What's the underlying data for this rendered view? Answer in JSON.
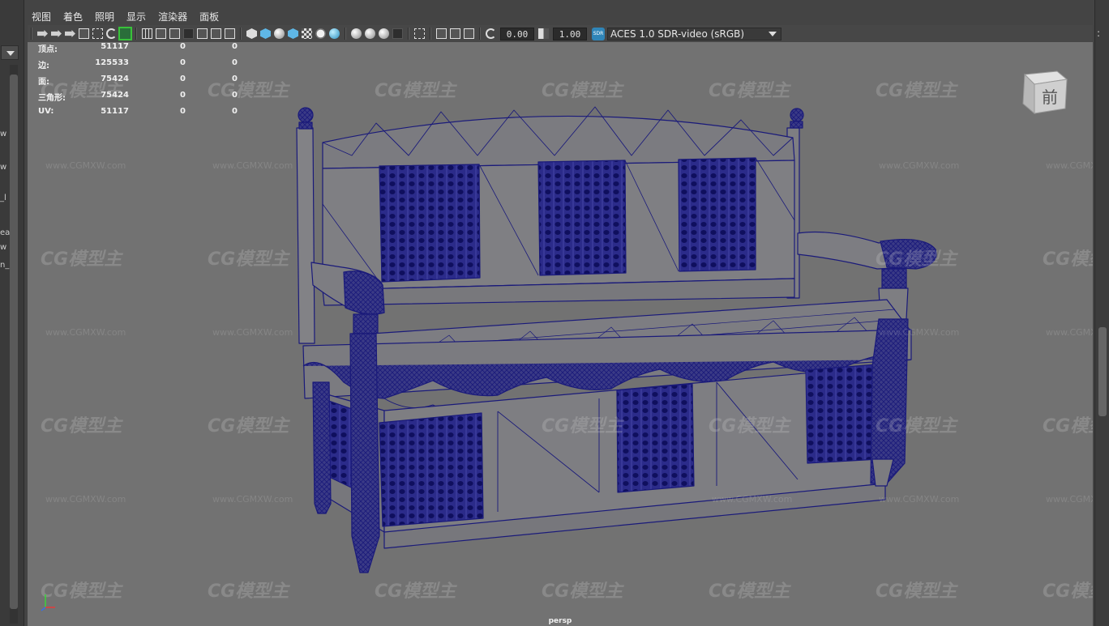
{
  "menu": [
    "视图",
    "着色",
    "照明",
    "显示",
    "渲染器",
    "面板"
  ],
  "toolbar": {
    "icons": [
      "camera-icon",
      "camera-attributes-icon",
      "bookmark-icon",
      "image-plane-icon",
      "grease-pencil-icon",
      "pencil-icon",
      "grid-icon",
      "film-gate-icon",
      "resolution-gate-icon",
      "gate-mask-icon",
      "field-chart-icon",
      "safe-action-icon",
      "safe-title-icon",
      "wireframe-icon",
      "smooth-shade-icon",
      "default-material-icon",
      "wireframe-on-shaded-icon",
      "textured-icon",
      "use-all-lights-icon",
      "shadows-icon",
      "screen-space-ambient-occlusion-icon",
      "motion-blur-icon",
      "multisample-aa-icon",
      "depth-of-field-icon",
      "isolate-select-icon",
      "xray-icon",
      "xray-joints-icon",
      "xray-components-icon",
      "gamma-icon",
      "exposure-icon"
    ],
    "exposure_value": "0.00",
    "gamma_value": "1.00",
    "color_icon_text": "SDR",
    "color_space": "ACES 1.0 SDR-video (sRGB)"
  },
  "hud": {
    "rows": [
      {
        "label": "顶点:",
        "v1": "51117",
        "v2": "0",
        "v3": "0"
      },
      {
        "label": "边:",
        "v1": "125533",
        "v2": "0",
        "v3": "0"
      },
      {
        "label": "面:",
        "v1": "75424",
        "v2": "0",
        "v3": "0"
      },
      {
        "label": "三角形:",
        "v1": "75424",
        "v2": "0",
        "v3": "0"
      },
      {
        "label": "UV:",
        "v1": "51117",
        "v2": "0",
        "v3": "0"
      }
    ]
  },
  "viewcube_label": "前",
  "camera_label": "persp",
  "watermark": {
    "logo": "CG模型主",
    "url": "www.CGMXW.com"
  },
  "left_dock": {
    "fragments": [
      "w",
      "w",
      "_l",
      "ea",
      "w",
      "n_"
    ]
  },
  "colors": {
    "viewport": "#727272",
    "wireframe": "#1a1a7a",
    "mesh_fill": "#7d7d80",
    "active_tool": "#39c13a"
  }
}
